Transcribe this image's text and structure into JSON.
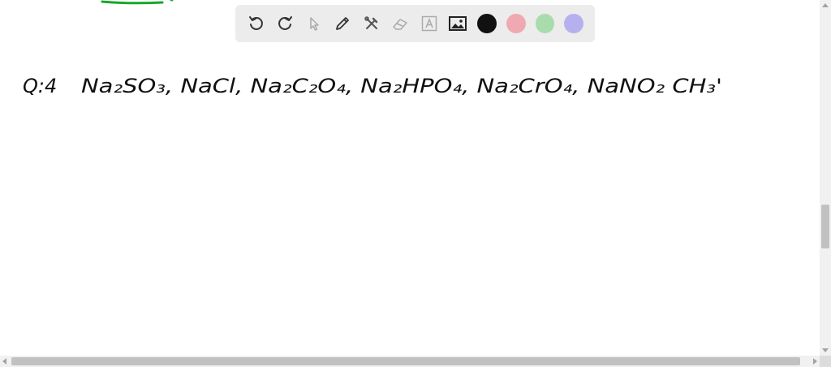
{
  "toolbar": {
    "tools": [
      {
        "name": "undo-button",
        "icon": "undo-icon"
      },
      {
        "name": "redo-button",
        "icon": "redo-icon"
      },
      {
        "name": "select-button",
        "icon": "pointer-icon"
      },
      {
        "name": "pen-button",
        "icon": "pencil-icon"
      },
      {
        "name": "tools-button",
        "icon": "tools-icon"
      },
      {
        "name": "eraser-button",
        "icon": "eraser-icon"
      },
      {
        "name": "text-button",
        "icon": "text-box-icon"
      },
      {
        "name": "image-button",
        "icon": "image-icon"
      }
    ],
    "colors": [
      "#111111",
      "#f0a9b0",
      "#a9dcac",
      "#b7b0ee"
    ]
  },
  "colors": {
    "stroke_green": "#17a82a",
    "ink": "#111111",
    "toolbar_bg": "#ececec",
    "icon": "#333333",
    "icon_disabled": "#aaaaaa"
  },
  "canvas": {
    "handwriting": {
      "question_label": "Q:4",
      "compounds": "Na₂SO₃, NaCl, Na₂C₂O₄, Na₂HPO₄, Na₂CrO₄, NaNO₂ CH₃'"
    }
  }
}
